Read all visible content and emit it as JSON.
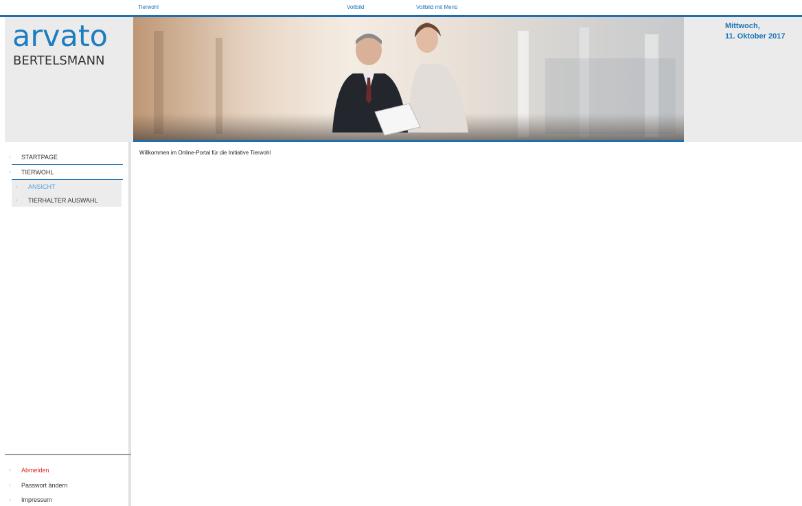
{
  "top_links": [
    "Tierwohl",
    "Vollbild",
    "Vollbild mit Menü"
  ],
  "logo": {
    "brand": "arvato",
    "sub": "BERTELSMANN"
  },
  "date": {
    "line1": "Mittwoch,",
    "line2": "11. Oktober 2017"
  },
  "sidebar": {
    "items": [
      {
        "label": "STARTPAGE"
      },
      {
        "label": "TIERWOHL"
      }
    ],
    "subitems": [
      {
        "label": "ANSICHT"
      },
      {
        "label": "TIERHALTER AUSWAHL"
      }
    ],
    "bottom_items": [
      {
        "label": "Abmelden"
      },
      {
        "label": "Passwort ändern"
      },
      {
        "label": "Impressum"
      }
    ]
  },
  "main": {
    "welcome": "Willkommen im Online-Portal für die Initiative Tierwohl"
  },
  "colors": {
    "accent": "#1f6fae",
    "link": "#1a74b8",
    "logout": "#d62b2b"
  }
}
